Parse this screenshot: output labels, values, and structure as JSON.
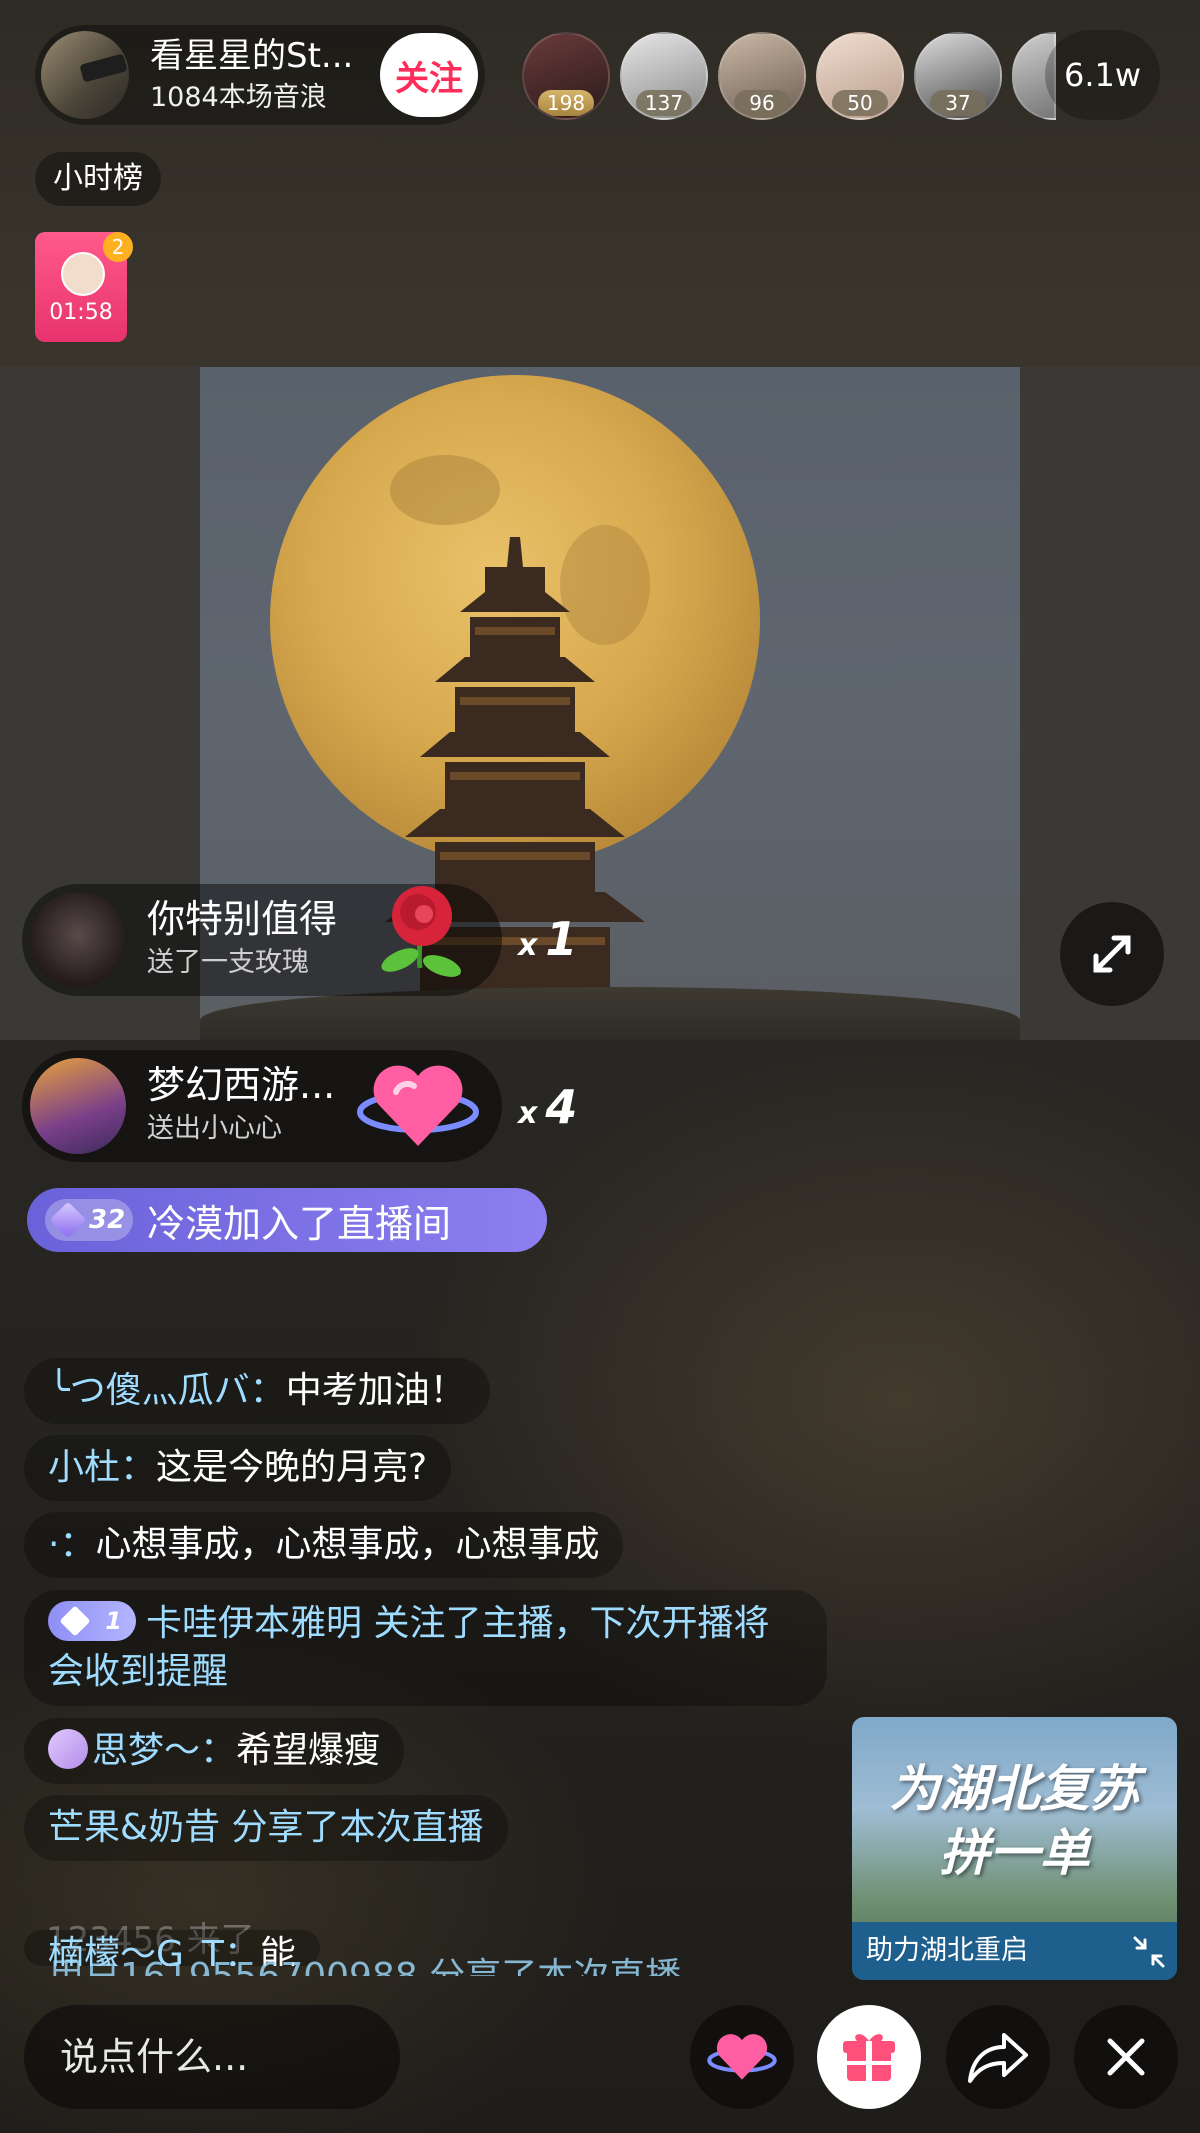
{
  "host": {
    "name": "看星星的St...",
    "subtitle": "1084本场音浪",
    "follow_label": "关注"
  },
  "top_viewers": [
    {
      "count": "198"
    },
    {
      "count": "137"
    },
    {
      "count": "96"
    },
    {
      "count": "50"
    },
    {
      "count": "37"
    }
  ],
  "audience_count": "6.1w",
  "hour_rank_label": "小时榜",
  "red_packet": {
    "badge": "2",
    "countdown": "01:58"
  },
  "gift_feed": [
    {
      "name": "你特别值得",
      "action": "送了一支玫瑰",
      "times": "1",
      "gift_icon": "rose-icon"
    },
    {
      "name": "梦幻西游...",
      "action": "送出小心心",
      "times": "4",
      "gift_icon": "heart-icon"
    }
  ],
  "gift_multiplier": "x",
  "join_notice": {
    "level": "32",
    "text": "冷漠加入了直播间"
  },
  "chat": [
    {
      "user": "╰つ傻灬瓜バ：",
      "msg": "中考加油！"
    },
    {
      "user": "小杜：",
      "msg": "这是今晚的月亮?"
    },
    {
      "user": "·：",
      "msg": "心想事成，心想事成，心想事成"
    },
    {
      "level": "1",
      "text": "卡哇伊本雅明 关注了主播，下次开播将会收到提醒"
    },
    {
      "user": "思梦～：",
      "msg": "希望爆瘦"
    },
    {
      "text": "芒果&奶昔 分享了本次直播"
    },
    {
      "text": "123456 来了"
    },
    {
      "user": "楠檬～G_T：",
      "msg": "能"
    },
    {
      "text": "用户1619556700988 分享了本次直播"
    }
  ],
  "promo": {
    "title_line1": "为湖北复苏",
    "title_line2": "拼一单",
    "footer": "助力湖北重启"
  },
  "input_placeholder": "说点什么...",
  "colors": {
    "follow": "#ff2d5a",
    "join_bar": "#7b72e6",
    "chat_user": "#9fdcff",
    "promo_bar": "#1e5f8d"
  }
}
